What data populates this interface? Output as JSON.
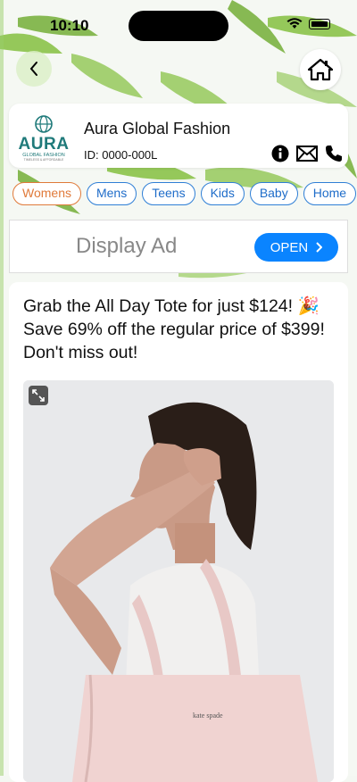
{
  "status_bar": {
    "time": "10:10"
  },
  "business": {
    "name": "Aura Global Fashion",
    "id_label": "ID: 0000-000L",
    "logo": {
      "word": "AURA",
      "sub": "GLOBAL FASHION",
      "tag": "TIMELESS & AFFORDABLE"
    }
  },
  "categories": [
    {
      "label": "Womens",
      "active": true
    },
    {
      "label": "Mens",
      "active": false
    },
    {
      "label": "Teens",
      "active": false
    },
    {
      "label": "Kids",
      "active": false
    },
    {
      "label": "Baby",
      "active": false
    },
    {
      "label": "Home",
      "active": false
    }
  ],
  "ad": {
    "text": "Display Ad",
    "button": "OPEN"
  },
  "post": {
    "text": "Grab the All Day Tote for just $124! 🎉 Save 69% off the regular price of $399! Don't miss out!",
    "image_brand_text": "kate spade"
  },
  "colors": {
    "tab_border": "#2f7fd6",
    "tab_active": "#e07a3a",
    "open_button": "#0a84ff",
    "logo_teal": "#1f7a7a"
  },
  "icons": {
    "back": "chevron-left-icon",
    "home": "home-icon",
    "info": "info-icon",
    "mail": "mail-icon",
    "phone": "phone-icon",
    "expand": "expand-icon"
  }
}
